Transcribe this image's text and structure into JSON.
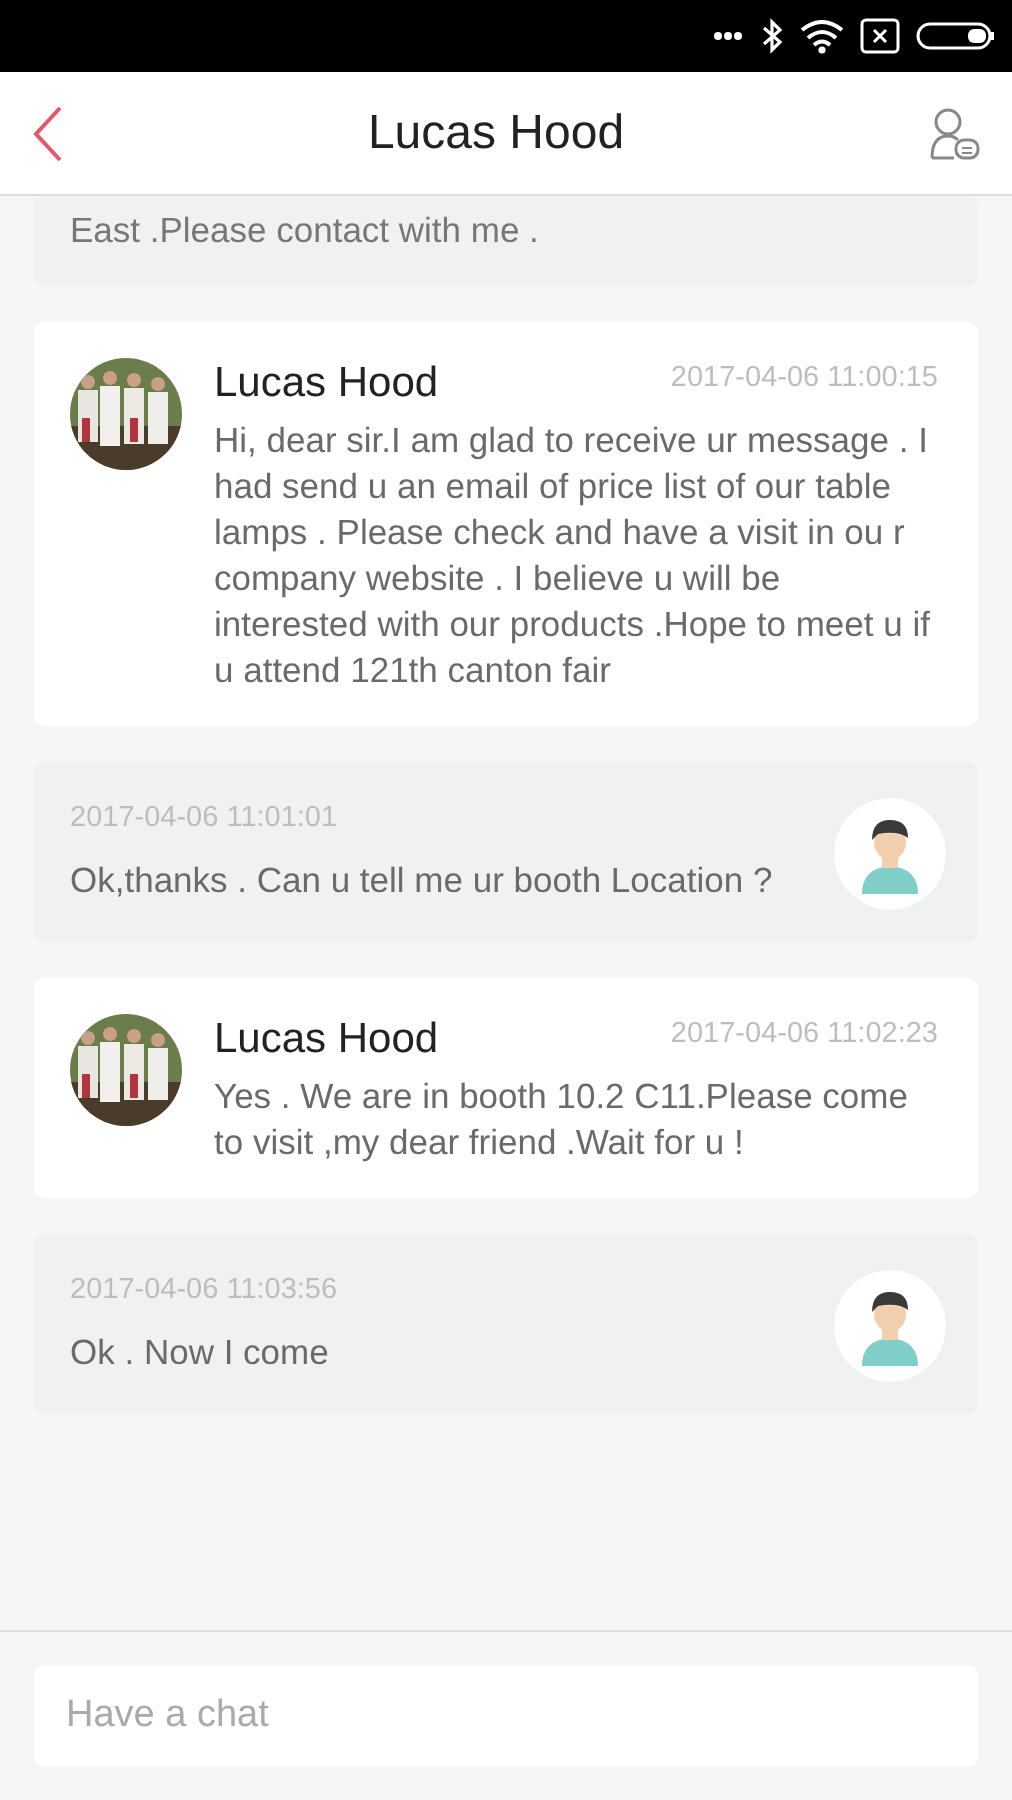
{
  "header": {
    "title": "Lucas Hood"
  },
  "messages": [
    {
      "kind": "fragment",
      "text": "East .Please contact with me  ."
    },
    {
      "kind": "incoming",
      "sender": "Lucas Hood",
      "time": "2017-04-06 11:00:15",
      "text": "Hi, dear sir.I am glad to receive ur message . I had send u an email of  price list of our table lamps . Please check and have a visit in ou r company website . I believe u will be interested with our products .Hope to meet u if u attend 121th canton fair"
    },
    {
      "kind": "outgoing",
      "time": "2017-04-06 11:01:01",
      "text": "Ok,thanks . Can  u tell me ur booth Location ?"
    },
    {
      "kind": "incoming",
      "sender": "Lucas Hood",
      "time": "2017-04-06 11:02:23",
      "text": "Yes . We are in booth 10.2 C11.Please come to visit ,my dear friend .Wait for u !"
    },
    {
      "kind": "outgoing",
      "time": "2017-04-06 11:03:56",
      "text": "Ok . Now I come"
    }
  ],
  "composer": {
    "placeholder": "Have a chat"
  }
}
